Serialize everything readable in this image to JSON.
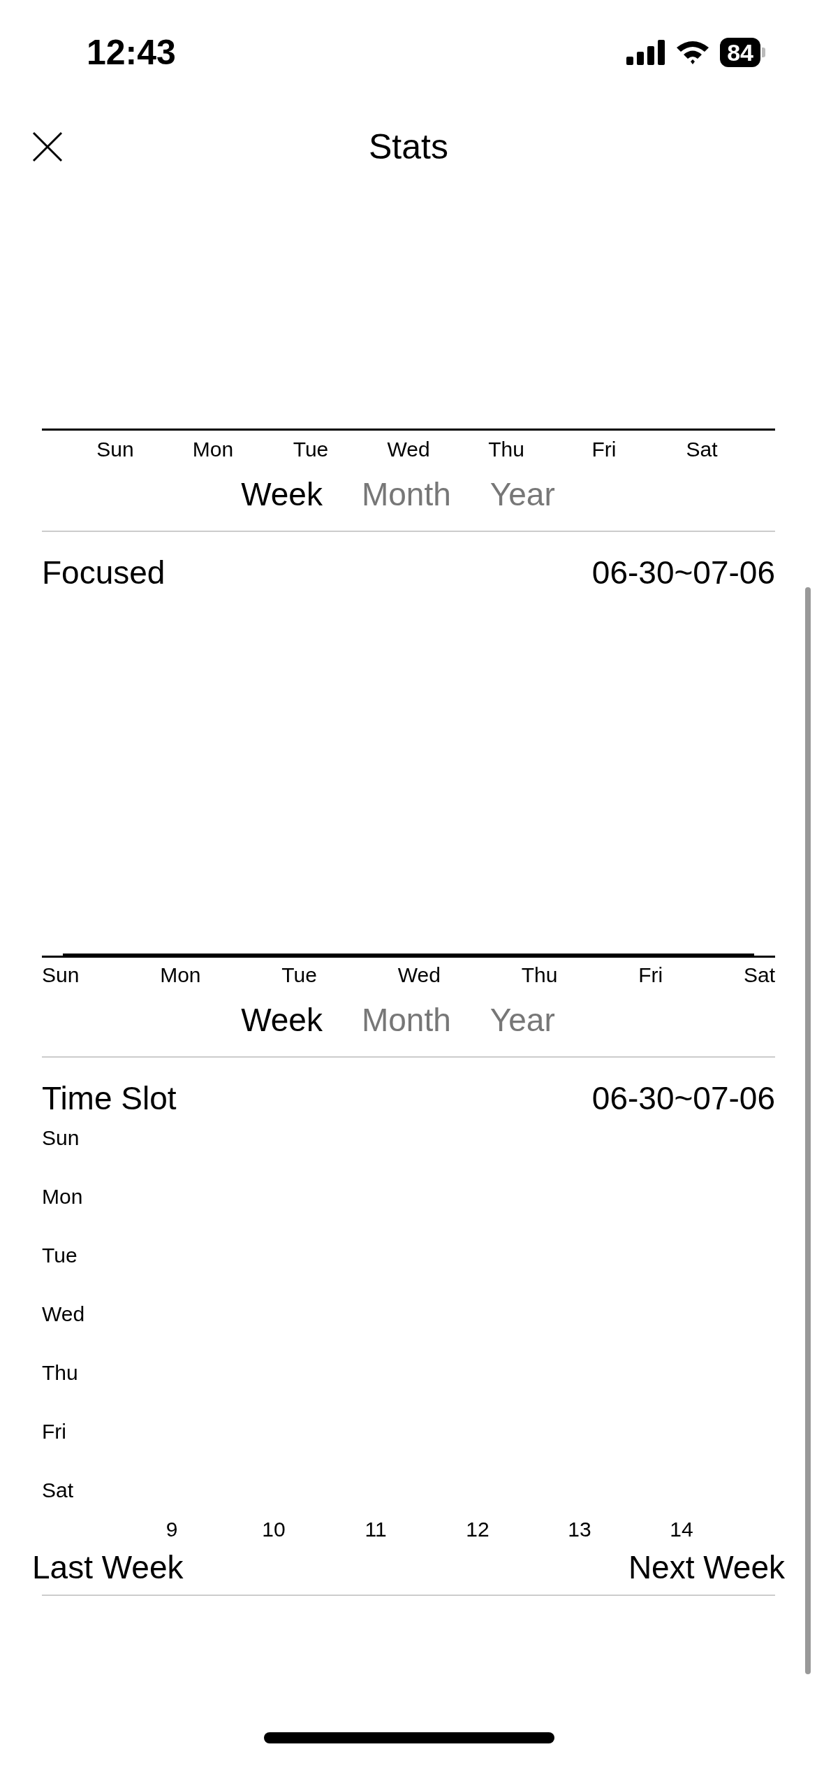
{
  "status_bar": {
    "time": "12:43",
    "battery": "84"
  },
  "nav": {
    "title": "Stats"
  },
  "top_chart": {
    "categories": [
      "Sun",
      "Mon",
      "Tue",
      "Wed",
      "Thu",
      "Fri",
      "Sat"
    ],
    "tabs": [
      {
        "label": "Week",
        "selected": true
      },
      {
        "label": "Month",
        "selected": false
      },
      {
        "label": "Year",
        "selected": false
      }
    ]
  },
  "focused": {
    "title": "Focused",
    "range": "06-30~07-06",
    "categories": [
      "Sun",
      "Mon",
      "Tue",
      "Wed",
      "Thu",
      "Fri",
      "Sat"
    ],
    "tabs": [
      {
        "label": "Week",
        "selected": true
      },
      {
        "label": "Month",
        "selected": false
      },
      {
        "label": "Year",
        "selected": false
      }
    ]
  },
  "time_slot": {
    "title": "Time Slot",
    "range": "06-30~07-06",
    "days": [
      "Sun",
      "Mon",
      "Tue",
      "Wed",
      "Thu",
      "Fri",
      "Sat"
    ],
    "hours": [
      "9",
      "10",
      "11",
      "12",
      "13",
      "14"
    ],
    "previous": "Last Week",
    "next": "Next Week"
  }
}
